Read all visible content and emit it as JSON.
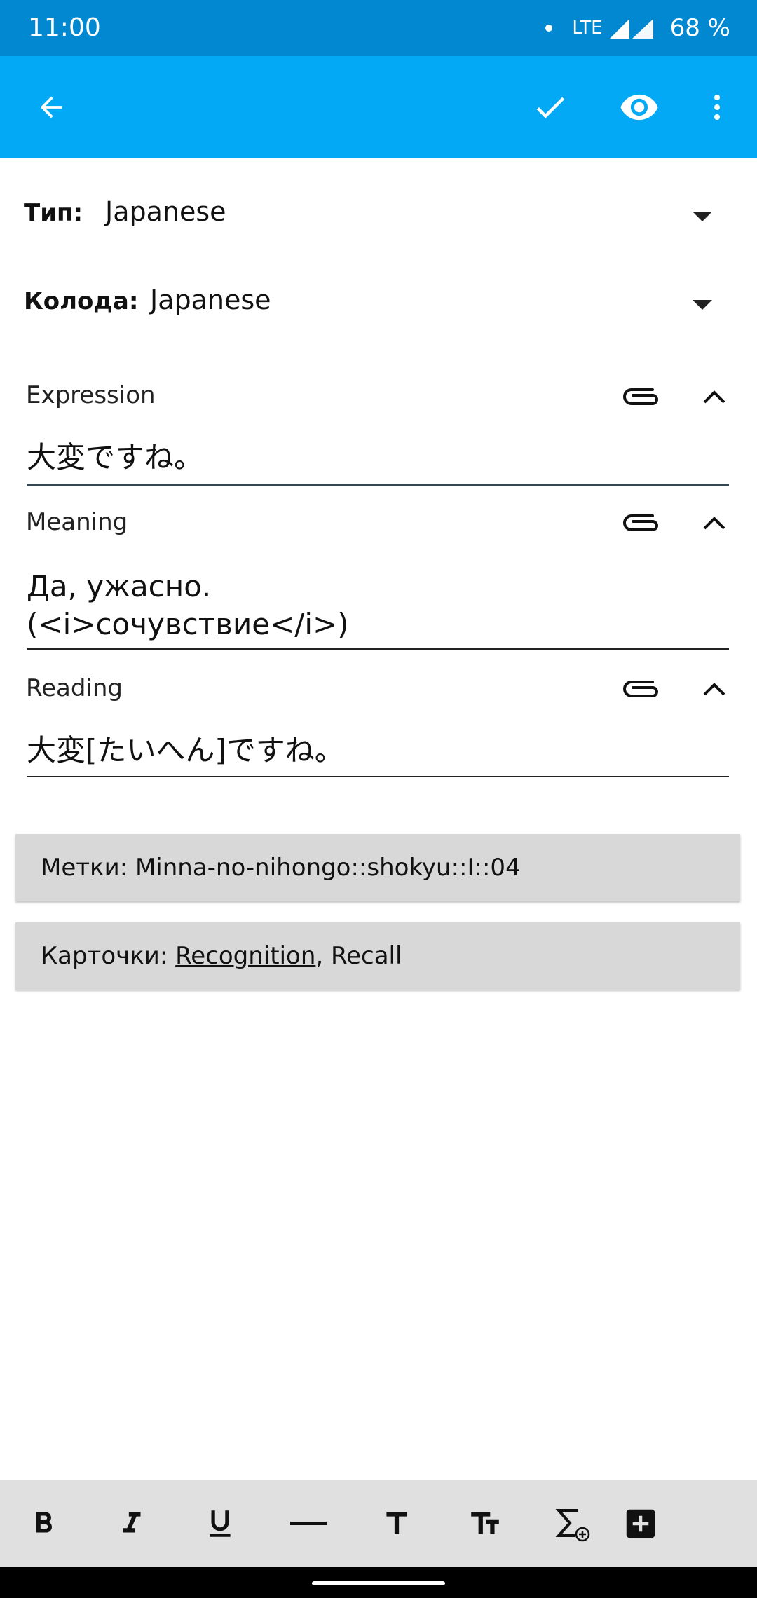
{
  "status_bar": {
    "time": "11:00",
    "network": "LTE",
    "battery": "68 %"
  },
  "type_row": {
    "label": "Тип:",
    "value": "Japanese"
  },
  "deck_row": {
    "label": "Колода:",
    "value": "Japanese"
  },
  "fields": [
    {
      "label": "Expression",
      "value": "大変ですね。"
    },
    {
      "label": "Meaning",
      "value_line1": "Да, ужасно.",
      "value_line2": "(<i>сочувствие</i>)"
    },
    {
      "label": "Reading",
      "value": "大変[たいへん]ですね。"
    }
  ],
  "tags": {
    "text": "Метки: Minna-no-nihongo::shokyu::I::04"
  },
  "cards": {
    "prefix": "Карточки: ",
    "first": "Recognition",
    "rest": ", Recall"
  },
  "colors": {
    "status_bar": "#0288d1",
    "app_bar": "#03a9f4",
    "toolbar": "#e0e0e0"
  },
  "icons": [
    "back-arrow-icon",
    "checkmark-icon",
    "eye-icon",
    "more-vert-icon",
    "paperclip-icon",
    "chevron-up-icon",
    "dropdown-caret-icon",
    "bold-icon",
    "italic-icon",
    "underline-icon",
    "horizontal-rule-icon",
    "text-size-icon",
    "text-size-small-icon",
    "math-sum-icon",
    "add-box-icon"
  ]
}
